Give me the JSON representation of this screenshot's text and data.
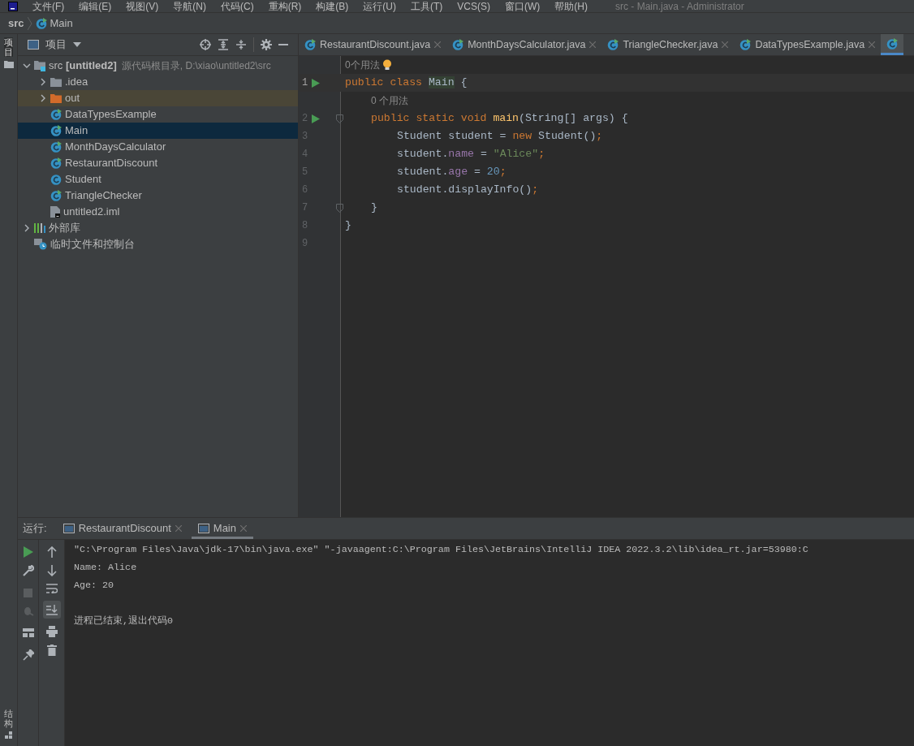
{
  "window": {
    "title": "src - Main.java - Administrator"
  },
  "menu": [
    "文件(F)",
    "编辑(E)",
    "视图(V)",
    "导航(N)",
    "代码(C)",
    "重构(R)",
    "构建(B)",
    "运行(U)",
    "工具(T)",
    "VCS(S)",
    "窗口(W)",
    "帮助(H)"
  ],
  "breadcrumb": [
    {
      "kind": "folder",
      "label": "src"
    },
    {
      "kind": "class",
      "label": "Main"
    }
  ],
  "side_strip": {
    "top": "项目",
    "bottom": "结构"
  },
  "project_panel": {
    "title": "项目",
    "tree": [
      {
        "kind": "module",
        "label": "src",
        "module": "[untitled2]",
        "path": "源代码根目录, D:\\xiao\\untitled2\\src",
        "expanded": true,
        "selected": false,
        "children": [
          {
            "kind": "folder",
            "label": ".idea",
            "expanded": false,
            "selected": false
          },
          {
            "kind": "excluded",
            "label": "out",
            "expanded": false,
            "selected": false
          },
          {
            "kind": "runnable",
            "label": "DataTypesExample",
            "selected": false
          },
          {
            "kind": "runnable",
            "label": "Main",
            "selected": true
          },
          {
            "kind": "runnable",
            "label": "MonthDaysCalculator",
            "selected": false
          },
          {
            "kind": "runnable",
            "label": "RestaurantDiscount",
            "selected": false
          },
          {
            "kind": "class",
            "label": "Student",
            "selected": false
          },
          {
            "kind": "runnable",
            "label": "TriangleChecker",
            "selected": false
          },
          {
            "kind": "iml",
            "label": "untitled2.iml",
            "selected": false
          }
        ]
      },
      {
        "kind": "library",
        "label": "外部库",
        "expanded": false,
        "selected": false
      },
      {
        "kind": "scratch",
        "label": "临时文件和控制台",
        "selected": false
      }
    ]
  },
  "editor_tabs": [
    {
      "label": "RestaurantDiscount.java",
      "selected": false
    },
    {
      "label": "MonthDaysCalculator.java",
      "selected": false
    },
    {
      "label": "TriangleChecker.java",
      "selected": false
    },
    {
      "label": "DataTypesExample.java",
      "selected": false
    },
    {
      "selected": true
    }
  ],
  "code": [
    {
      "kind": "hint",
      "text": "0个用法",
      "bulb": true
    },
    {
      "kind": "line",
      "number": "1",
      "run": true,
      "fold": false,
      "current": true,
      "tokens": [
        {
          "kind": "keyword",
          "text": "public class "
        },
        {
          "kind": "match",
          "text": "Main"
        },
        {
          "kind": "plain",
          "text": " {"
        }
      ],
      "children": [
        {
          "kind": "hint",
          "text": "0 个用法",
          "bulb": false
        },
        {
          "kind": "line",
          "number": "2",
          "run": true,
          "fold": true,
          "current": false,
          "tokens": [
            {
              "kind": "keyword",
              "text": "public static void "
            },
            {
              "kind": "method",
              "text": "main"
            },
            {
              "kind": "plain",
              "text": "(String[] args) {"
            }
          ],
          "children": [
            {
              "kind": "line",
              "number": "3",
              "run": false,
              "fold": false,
              "current": false,
              "tokens": [
                {
                  "kind": "plain",
                  "text": "Student student = "
                },
                {
                  "kind": "keyword",
                  "text": "new "
                },
                {
                  "kind": "plain",
                  "text": "Student()"
                },
                {
                  "kind": "keyword",
                  "text": ";"
                }
              ]
            },
            {
              "kind": "line",
              "number": "4",
              "run": false,
              "fold": false,
              "current": false,
              "tokens": [
                {
                  "kind": "plain",
                  "text": "student."
                },
                {
                  "kind": "field",
                  "text": "name"
                },
                {
                  "kind": "plain",
                  "text": " = "
                },
                {
                  "kind": "string",
                  "text": "\"Alice\""
                },
                {
                  "kind": "keyword",
                  "text": ";"
                }
              ]
            },
            {
              "kind": "line",
              "number": "5",
              "run": false,
              "fold": false,
              "current": false,
              "tokens": [
                {
                  "kind": "plain",
                  "text": "student."
                },
                {
                  "kind": "field",
                  "text": "age"
                },
                {
                  "kind": "plain",
                  "text": " = "
                },
                {
                  "kind": "number",
                  "text": "20"
                },
                {
                  "kind": "keyword",
                  "text": ";"
                }
              ]
            },
            {
              "kind": "line",
              "number": "6",
              "run": false,
              "fold": false,
              "current": false,
              "tokens": [
                {
                  "kind": "plain",
                  "text": "student.displayInfo()"
                },
                {
                  "kind": "keyword",
                  "text": ";"
                }
              ]
            }
          ]
        },
        {
          "kind": "line",
          "number": "7",
          "run": false,
          "fold": true,
          "current": false,
          "tokens": [
            {
              "kind": "plain",
              "text": "}"
            }
          ]
        }
      ]
    },
    {
      "kind": "line",
      "number": "8",
      "run": false,
      "fold": false,
      "current": false,
      "tokens": [
        {
          "kind": "plain",
          "text": "}"
        }
      ]
    },
    {
      "kind": "line",
      "number": "9",
      "run": false,
      "fold": false,
      "current": false
    }
  ],
  "run_panel": {
    "label": "运行:",
    "tabs": [
      {
        "label": "RestaurantDiscount",
        "selected": false
      },
      {
        "label": "Main",
        "selected": true
      }
    ],
    "console": [
      {
        "kind": "output",
        "text": "\"C:\\Program Files\\Java\\jdk-17\\bin\\java.exe\" \"-javaagent:C:\\Program Files\\JetBrains\\IntelliJ IDEA 2022.3.2\\lib\\idea_rt.jar=53980:C"
      },
      {
        "kind": "output",
        "text": "Name: Alice"
      },
      {
        "kind": "output",
        "text": "Age: 20"
      },
      {
        "kind": "exit",
        "text": "进程已结束,退出代码0"
      }
    ]
  }
}
